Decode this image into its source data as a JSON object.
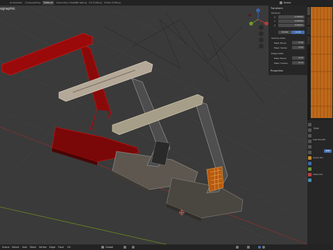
{
  "topbar": {
    "tabs": [
      {
        "label": "Animation",
        "active": false
      },
      {
        "label": "Compositing",
        "active": false
      },
      {
        "label": "Default",
        "active": true
      },
      {
        "label": "Geometry Nodes",
        "active": false
      },
      {
        "label": "Scripting",
        "active": false
      },
      {
        "label": "UV Editing",
        "active": false
      },
      {
        "label": "Video Editing",
        "active": false
      }
    ],
    "scene": "Scene"
  },
  "viewport": {
    "label": "ographic",
    "gizmo": {
      "x": "X",
      "y": "Y",
      "z": "Z"
    }
  },
  "npanel": {
    "transform_title": "Transform",
    "medium_label": "Medium",
    "axes": [
      {
        "axis": "X",
        "value": "-0.00000"
      },
      {
        "axis": "Y",
        "value": "0.00000"
      },
      {
        "axis": "Z",
        "value": "0.00001"
      }
    ],
    "global_label": "Global",
    "local_label": "Local",
    "vertices_data": "Vertices Data:",
    "mean_bevel_1": "Mean Bevel",
    "mean_bevel_1_value": "0.00",
    "mean_vertex": "Mean Vertex",
    "mean_vertex_value": "0.00",
    "edges_data": "Edges Data:",
    "mean_bevel_2": "Mean Bevel",
    "mean_bevel_2_value": "0.00",
    "mean_crease": "Mean Crease",
    "mean_crease_value": "0.11",
    "properties_title": "Properties",
    "tabs": [
      "Item",
      "Tool",
      "View",
      "Edit"
    ]
  },
  "props": {
    "items": [
      "Click",
      "Auto Smooth",
      "Edit",
      "Lorem Visi",
      "Advanced"
    ]
  },
  "statusbar": {
    "items": [
      "Scene",
      "Select",
      "Add",
      "Mesh",
      "Vertex",
      "Edge",
      "Face",
      "UV"
    ],
    "transform": "Global"
  },
  "colors": {
    "red_lamp": "#9a0a0a",
    "grey_lamp": "#6f6f6f",
    "accent": "#4772b3",
    "uv_orange": "#c06a1a"
  }
}
